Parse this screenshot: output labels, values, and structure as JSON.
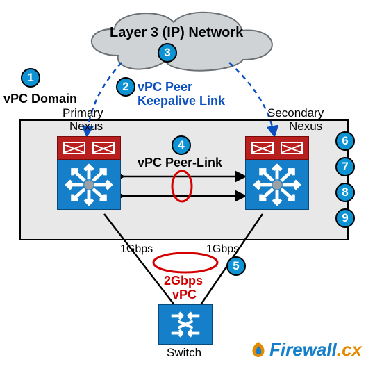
{
  "layer3_title": "Layer 3 (IP) Network",
  "vpc_domain_label": "vPC Domain",
  "keepalive_label_l1": "vPC Peer",
  "keepalive_label_l2": "Keepalive Link",
  "primary_label_l1": "Primary",
  "primary_label_l2": "Nexus",
  "secondary_label_l1": "Secondary",
  "secondary_label_l2": "Nexus",
  "peerlink_label": "vPC  Peer-Link",
  "down_left_speed": "1Gbps",
  "down_right_speed": "1Gbps",
  "agg_speed": "2Gbps",
  "agg_label": "vPC",
  "switch_label": "Switch",
  "logo_text_a": "Firewall",
  "logo_text_b": ".cx",
  "badges": {
    "b1": "1",
    "b2": "2",
    "b3": "3",
    "b4": "4",
    "b5": "5",
    "b6": "6",
    "b7": "7",
    "b8": "8",
    "b9": "9"
  }
}
